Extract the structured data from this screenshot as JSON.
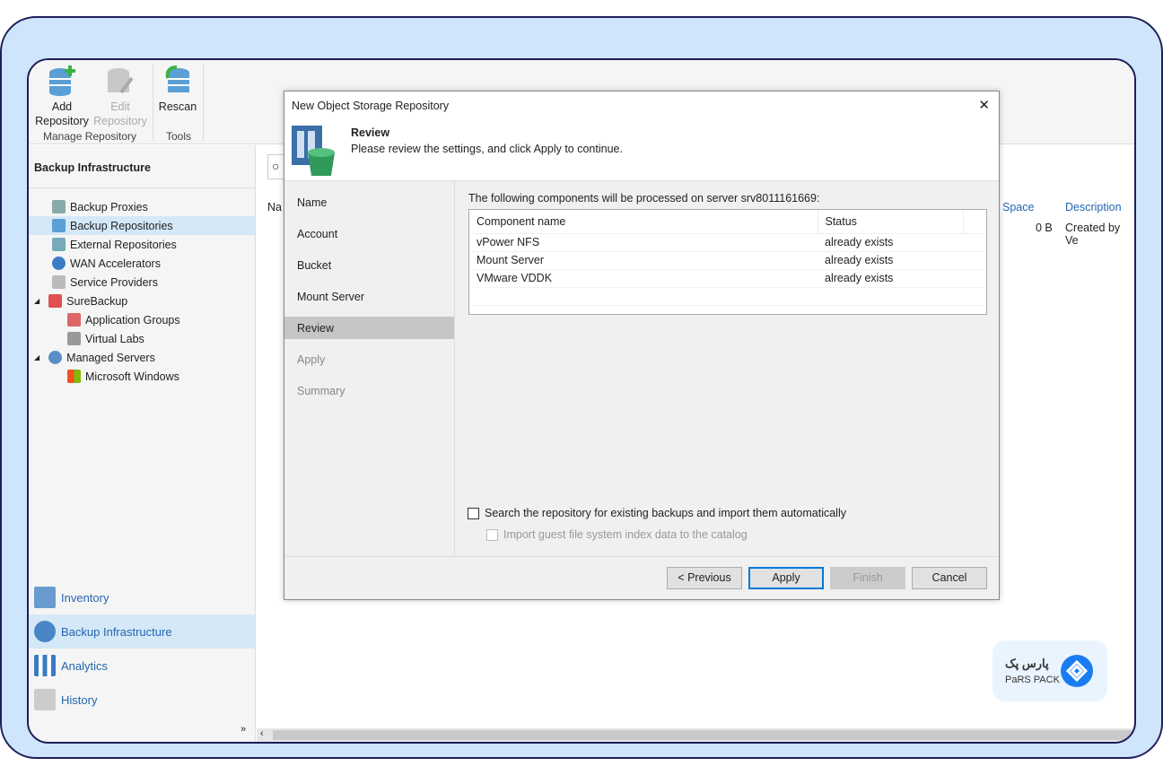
{
  "ribbon": {
    "add": [
      "Add",
      "Repository"
    ],
    "edit": [
      "Edit",
      "Repository"
    ],
    "rescan": "Rescan",
    "group_manage": "Manage Repository",
    "group_tools": "Tools"
  },
  "left": {
    "title": "Backup Infrastructure",
    "tree": [
      {
        "label": "Backup Proxies"
      },
      {
        "label": "Backup Repositories"
      },
      {
        "label": "External Repositories"
      },
      {
        "label": "WAN Accelerators"
      },
      {
        "label": "Service Providers"
      },
      {
        "label": "SureBackup"
      },
      {
        "label": "Application Groups"
      },
      {
        "label": "Virtual Labs"
      },
      {
        "label": "Managed Servers"
      },
      {
        "label": "Microsoft Windows"
      }
    ],
    "nav": [
      {
        "label": "Inventory"
      },
      {
        "label": "Backup Infrastructure"
      },
      {
        "label": "Analytics"
      },
      {
        "label": "History"
      }
    ]
  },
  "main": {
    "col_name": "Na",
    "col_space": "Space",
    "col_desc": "Description",
    "row_space": "0 B",
    "row_desc": "Created by Ve"
  },
  "dialog": {
    "title": "New Object Storage Repository",
    "close": "✕",
    "heading": "Review",
    "subheading": "Please review the settings, and click Apply to continue.",
    "steps": [
      {
        "label": "Name"
      },
      {
        "label": "Account"
      },
      {
        "label": "Bucket"
      },
      {
        "label": "Mount Server"
      },
      {
        "label": "Review"
      },
      {
        "label": "Apply"
      },
      {
        "label": "Summary"
      }
    ],
    "intro": "The following components will be processed on server srv8011161669:",
    "table": {
      "headers": [
        "Component name",
        "Status"
      ],
      "rows": [
        [
          "vPower NFS",
          "already exists"
        ],
        [
          "Mount Server",
          "already exists"
        ],
        [
          "VMware VDDK",
          "already exists"
        ]
      ]
    },
    "check_search": "Search the repository for existing backups and import them automatically",
    "check_import": "Import guest file system index data to the catalog",
    "buttons": {
      "previous": "< Previous",
      "apply": "Apply",
      "finish": "Finish",
      "cancel": "Cancel"
    }
  },
  "logo": {
    "fa": "پارس پک",
    "en": "Pars Pack"
  },
  "colors": {
    "frame": "#cfe5fc",
    "border": "#1e1f5a",
    "accent": "#2465b0",
    "logo": "#1a7cf0"
  }
}
